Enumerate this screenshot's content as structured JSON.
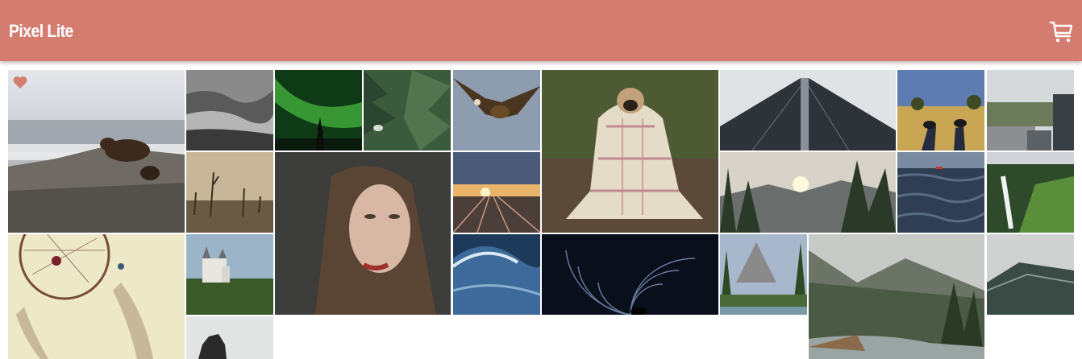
{
  "app": {
    "title": "Pixel Lite",
    "accent_color": "#d57c70",
    "cart_icon": "cart-icon",
    "favorite_icon": "heart-icon",
    "favorite_color": "#d57c70"
  },
  "gallery": {
    "photos": [
      {
        "name": "photo-bear"
      },
      {
        "name": "photo-foggy-forest"
      },
      {
        "name": "photo-aurora"
      },
      {
        "name": "photo-pine-bird"
      },
      {
        "name": "photo-eagle"
      },
      {
        "name": "photo-pug-blanket"
      },
      {
        "name": "photo-skyscraper"
      },
      {
        "name": "photo-sneakers-field"
      },
      {
        "name": "photo-city-park"
      },
      {
        "name": "photo-dead-trees"
      },
      {
        "name": "photo-woman-portrait"
      },
      {
        "name": "photo-railway-sunset"
      },
      {
        "name": "photo-valley-sunset"
      },
      {
        "name": "photo-lake-waves"
      },
      {
        "name": "photo-waterfall"
      },
      {
        "name": "photo-dreamcatcher"
      },
      {
        "name": "photo-castle"
      },
      {
        "name": "photo-ocean-wave"
      },
      {
        "name": "photo-star-trails"
      },
      {
        "name": "photo-yosemite"
      },
      {
        "name": "photo-misty-river"
      },
      {
        "name": "photo-misty-mountain"
      },
      {
        "name": "photo-rock-sea"
      }
    ]
  }
}
